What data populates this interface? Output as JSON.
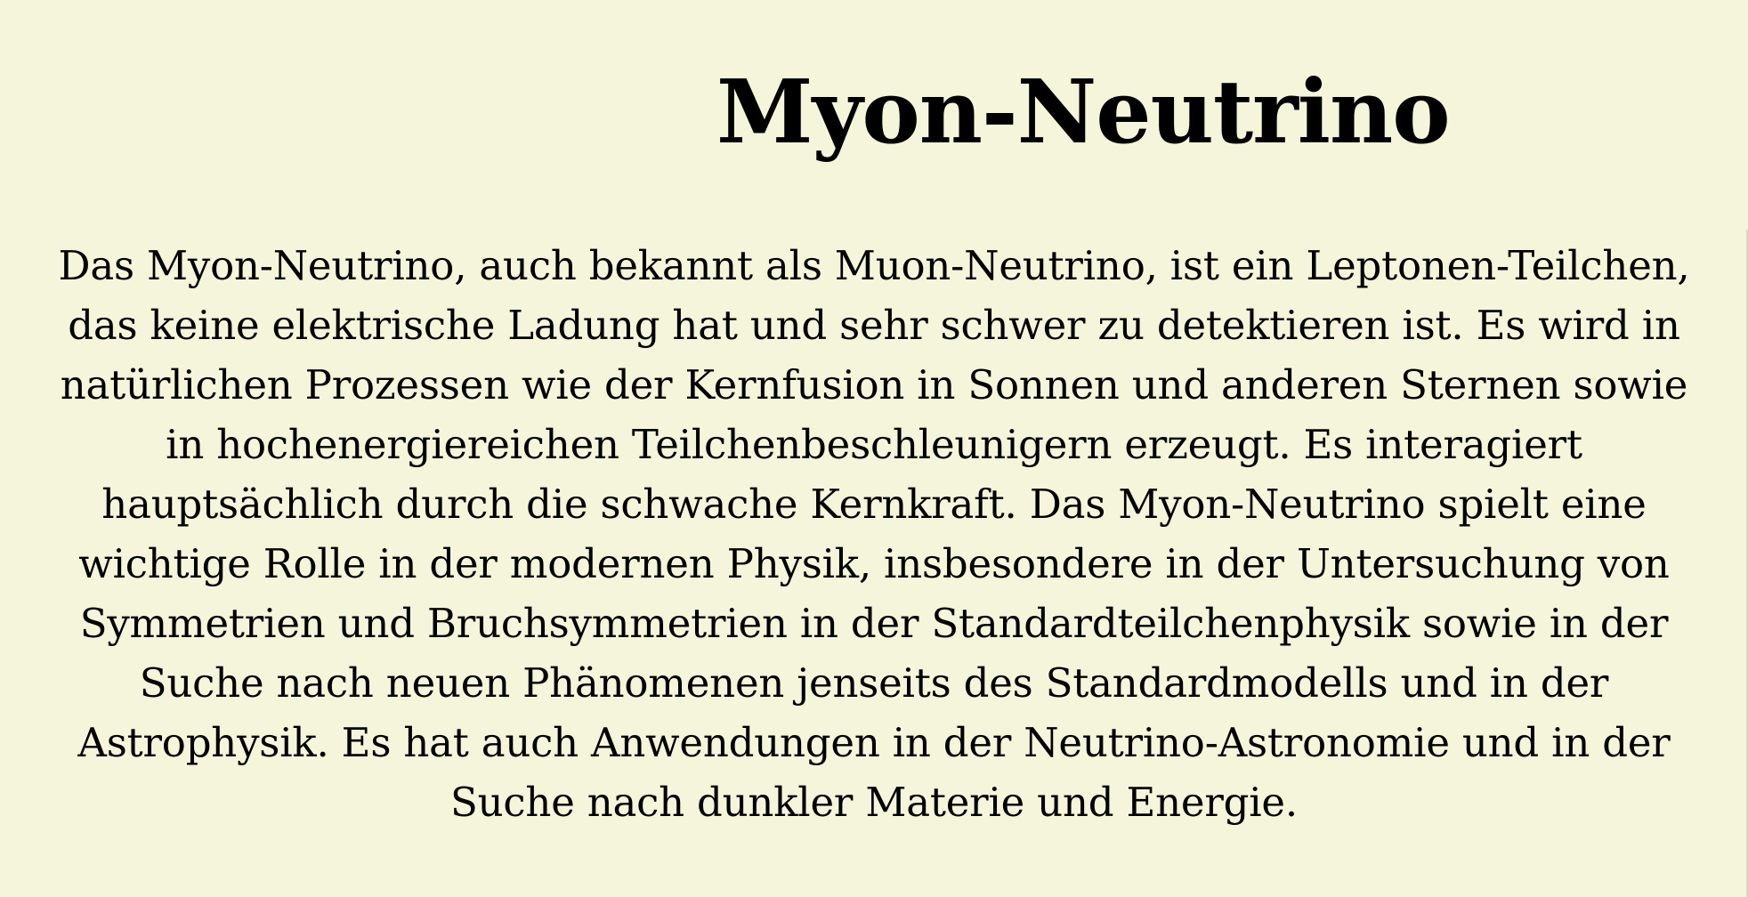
{
  "document": {
    "title": "Myon-Neutrino",
    "body": "Das Myon-Neutrino, auch bekannt als Muon-Neutrino, ist ein Leptonen-Teilchen, das keine elektrische Ladung hat und sehr schwer zu detektieren ist. Es wird in natürlichen Prozessen wie der Kernfusion in Sonnen und anderen Sternen sowie in hochenergiereichen Teilchenbeschleunigern erzeugt. Es interagiert hauptsächlich durch die schwache Kernkraft. Das Myon-Neutrino spielt eine wichtige Rolle in der modernen Physik, insbesondere in der Untersuchung von Symmetrien und Bruchsymmetrien in der Standardteilchenphysik sowie in der Suche nach neuen Phänomenen jenseits des Standardmodells und in der Astrophysik. Es hat auch Anwendungen in der Neutrino-Astronomie und in der Suche nach dunkler Materie und Energie."
  },
  "colors": {
    "background": "#f5f5dc",
    "text": "#000000"
  }
}
